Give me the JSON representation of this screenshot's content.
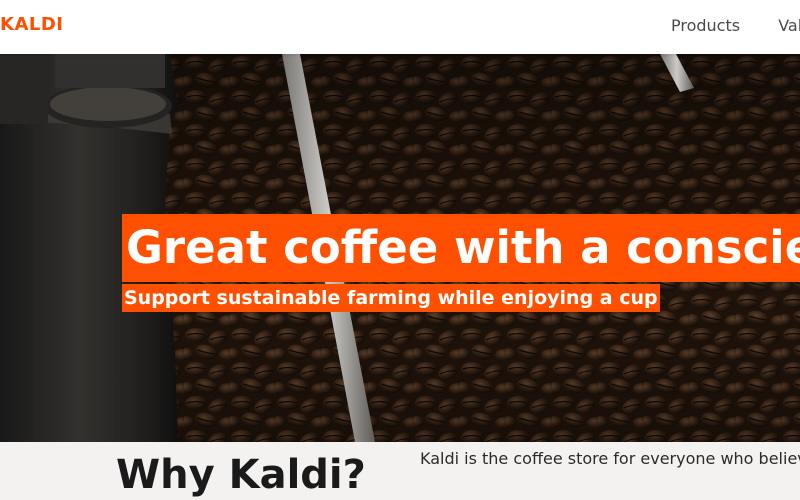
{
  "header": {
    "logo": "KALDI",
    "nav": [
      {
        "label": "Products"
      },
      {
        "label": "Values"
      }
    ]
  },
  "hero": {
    "title": "Great coffee with a conscience",
    "subtitle": "Support sustainable farming while enjoying a cup"
  },
  "about": {
    "heading": "Why Kaldi?",
    "text": "Kaldi is the coffee store for everyone who believes that great coffee shouldn't just taste good"
  },
  "colors": {
    "accent": "#ff4f00",
    "hero_bg": "#1a120c",
    "about_bg": "#f4f2f0"
  },
  "icons": {
    "hero_image": "coffee-roaster-beans-photo"
  }
}
